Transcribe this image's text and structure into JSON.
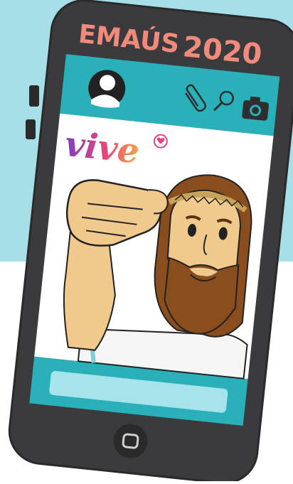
{
  "title": {
    "prefix": "EMAÚS",
    "year": "2020"
  },
  "brand_word": "vive",
  "colors": {
    "background_top": "#a6dfe8",
    "phone_body": "#3b3b3d",
    "phone_border": "#2a2a2b",
    "screen_bar": "#2ab0b8",
    "input_bar": "#a6e3ea",
    "title_pink": "#f08a7c",
    "icon_dark": "#2e2e2e"
  },
  "icons": {
    "avatar": "user-avatar-icon",
    "attach": "paperclip-icon",
    "search": "search-icon",
    "camera": "camera-icon",
    "heart": "heart-icon",
    "home": "home-button-icon"
  }
}
